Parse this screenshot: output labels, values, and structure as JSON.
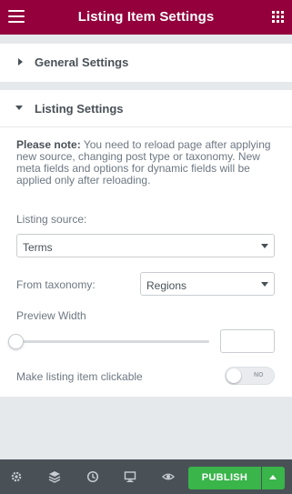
{
  "header": {
    "title": "Listing Item Settings",
    "menu_icon": "hamburger-icon",
    "apps_icon": "grid-icon"
  },
  "sections": {
    "general": {
      "label": "General Settings",
      "state": "collapsed"
    },
    "listing": {
      "label": "Listing Settings",
      "state": "expanded"
    }
  },
  "note": {
    "strong": "Please note:",
    "text": " You need to reload page after applying new source, changing post type or taxonomy. New meta fields and options for dynamic fields will be applied only after reloading."
  },
  "listing_source": {
    "label": "Listing source:",
    "value": "Terms"
  },
  "from_taxonomy": {
    "label": "From taxonomy:",
    "value": "Regions"
  },
  "preview_width": {
    "label": "Preview Width",
    "value": "",
    "slider_fraction": 0
  },
  "clickable": {
    "label": "Make listing item clickable",
    "toggle_text": "NO",
    "checked": false
  },
  "footer": {
    "icons": [
      "gear-icon",
      "layers-icon",
      "history-icon",
      "responsive-icon",
      "preview-eye-icon"
    ],
    "publish_label": "PUBLISH"
  },
  "colors": {
    "header_bg": "#93003c",
    "publish_bg": "#39b54a",
    "footer_bg": "#495157"
  }
}
